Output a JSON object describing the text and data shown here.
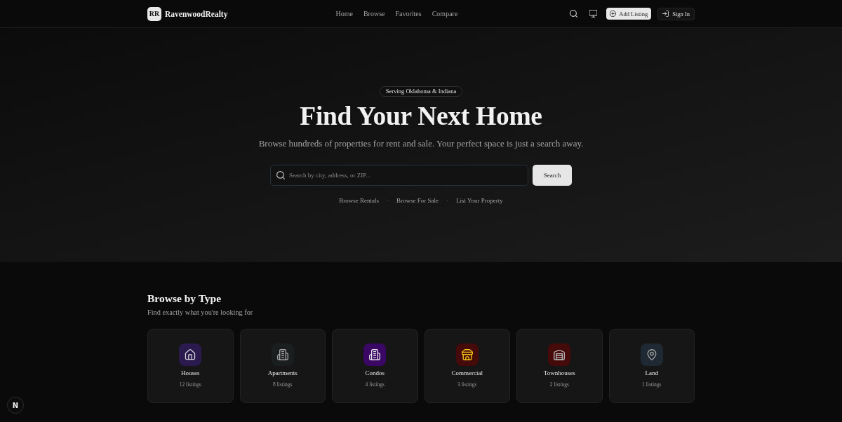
{
  "nav": {
    "logo_mark": "RR",
    "brand": "RavenwoodRealty",
    "links": [
      {
        "label": "Home"
      },
      {
        "label": "Browse"
      },
      {
        "label": "Favorites"
      },
      {
        "label": "Compare"
      }
    ],
    "add_button": "Add Listing",
    "sign_in_button": "Sign In"
  },
  "hero": {
    "badge": "Serving Oklahoma & Indiana",
    "title": "Find Your Next Home",
    "subtitle": "Browse hundreds of properties for rent and sale. Your perfect space is just a search away.",
    "search": {
      "placeholder": "Search by city, address, or ZIP...",
      "button": "Search"
    },
    "separator": "·",
    "links": [
      "Browse Rentals",
      "Browse For Sale",
      "List Your Property"
    ]
  },
  "browse": {
    "title": "Browse by Type",
    "subtitle": "Find exactly what you're looking for",
    "types": [
      {
        "name": "Houses",
        "count": "12 listings",
        "color": "#2b1a4d",
        "icon": {
          "kind": "house",
          "color": "#d4d4d8"
        }
      },
      {
        "name": "Apartments",
        "count": "8 listings",
        "color": "#1b1e1e",
        "icon": {
          "kind": "building",
          "color": "#a8a8a8"
        }
      },
      {
        "name": "Condos",
        "count": "4 listings",
        "color": "#3b0764",
        "icon": {
          "kind": "building",
          "color": "#e4e4e7"
        }
      },
      {
        "name": "Commercial",
        "count": "3 listings",
        "color": "#450a0a",
        "icon": {
          "kind": "store",
          "color": "#facc15"
        }
      },
      {
        "name": "Townhouses",
        "count": "2 listings",
        "color": "#450a0a",
        "icon": {
          "kind": "warehouse",
          "color": "#b8b8b8"
        }
      },
      {
        "name": "Land",
        "count": "1 listings",
        "color": "#1e2933",
        "icon": {
          "kind": "pin",
          "color": "#a3a3a3"
        }
      }
    ]
  },
  "dev_badge": "N"
}
